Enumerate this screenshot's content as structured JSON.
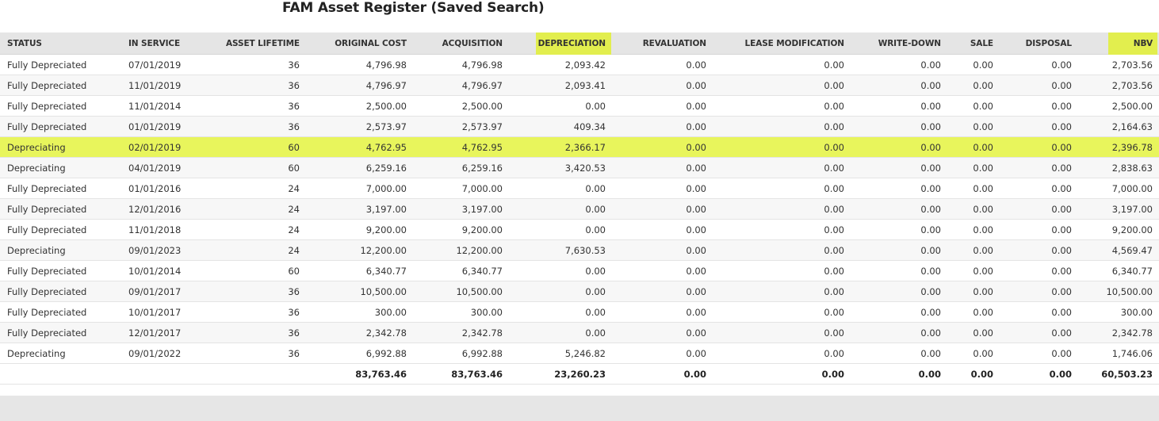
{
  "page": {
    "title": "FAM Asset Register (Saved Search)"
  },
  "colors": {
    "header_bg": "#e5e5e5",
    "highlight": "#e8f55c",
    "header_highlight": "#e2ee4e"
  },
  "table": {
    "columns": [
      "STATUS",
      "IN SERVICE",
      "ASSET LIFETIME",
      "ORIGINAL COST",
      "ACQUISITION",
      "DEPRECIATION",
      "REVALUATION",
      "LEASE MODIFICATION",
      "WRITE-DOWN",
      "SALE",
      "DISPOSAL",
      "NBV"
    ],
    "highlighted_columns": [
      "DEPRECIATION",
      "NBV"
    ],
    "rows": [
      [
        "Fully Depreciated",
        "07/01/2019",
        "36",
        "4,796.98",
        "4,796.98",
        "2,093.42",
        "0.00",
        "0.00",
        "0.00",
        "0.00",
        "0.00",
        "2,703.56"
      ],
      [
        "Fully Depreciated",
        "11/01/2019",
        "36",
        "4,796.97",
        "4,796.97",
        "2,093.41",
        "0.00",
        "0.00",
        "0.00",
        "0.00",
        "0.00",
        "2,703.56"
      ],
      [
        "Fully Depreciated",
        "11/01/2014",
        "36",
        "2,500.00",
        "2,500.00",
        "0.00",
        "0.00",
        "0.00",
        "0.00",
        "0.00",
        "0.00",
        "2,500.00"
      ],
      [
        "Fully Depreciated",
        "01/01/2019",
        "36",
        "2,573.97",
        "2,573.97",
        "409.34",
        "0.00",
        "0.00",
        "0.00",
        "0.00",
        "0.00",
        "2,164.63"
      ],
      [
        "Depreciating",
        "02/01/2019",
        "60",
        "4,762.95",
        "4,762.95",
        "2,366.17",
        "0.00",
        "0.00",
        "0.00",
        "0.00",
        "0.00",
        "2,396.78"
      ],
      [
        "Depreciating",
        "04/01/2019",
        "60",
        "6,259.16",
        "6,259.16",
        "3,420.53",
        "0.00",
        "0.00",
        "0.00",
        "0.00",
        "0.00",
        "2,838.63"
      ],
      [
        "Fully Depreciated",
        "01/01/2016",
        "24",
        "7,000.00",
        "7,000.00",
        "0.00",
        "0.00",
        "0.00",
        "0.00",
        "0.00",
        "0.00",
        "7,000.00"
      ],
      [
        "Fully Depreciated",
        "12/01/2016",
        "24",
        "3,197.00",
        "3,197.00",
        "0.00",
        "0.00",
        "0.00",
        "0.00",
        "0.00",
        "0.00",
        "3,197.00"
      ],
      [
        "Fully Depreciated",
        "11/01/2018",
        "24",
        "9,200.00",
        "9,200.00",
        "0.00",
        "0.00",
        "0.00",
        "0.00",
        "0.00",
        "0.00",
        "9,200.00"
      ],
      [
        "Depreciating",
        "09/01/2023",
        "24",
        "12,200.00",
        "12,200.00",
        "7,630.53",
        "0.00",
        "0.00",
        "0.00",
        "0.00",
        "0.00",
        "4,569.47"
      ],
      [
        "Fully Depreciated",
        "10/01/2014",
        "60",
        "6,340.77",
        "6,340.77",
        "0.00",
        "0.00",
        "0.00",
        "0.00",
        "0.00",
        "0.00",
        "6,340.77"
      ],
      [
        "Fully Depreciated",
        "09/01/2017",
        "36",
        "10,500.00",
        "10,500.00",
        "0.00",
        "0.00",
        "0.00",
        "0.00",
        "0.00",
        "0.00",
        "10,500.00"
      ],
      [
        "Fully Depreciated",
        "10/01/2017",
        "36",
        "300.00",
        "300.00",
        "0.00",
        "0.00",
        "0.00",
        "0.00",
        "0.00",
        "0.00",
        "300.00"
      ],
      [
        "Fully Depreciated",
        "12/01/2017",
        "36",
        "2,342.78",
        "2,342.78",
        "0.00",
        "0.00",
        "0.00",
        "0.00",
        "0.00",
        "0.00",
        "2,342.78"
      ],
      [
        "Depreciating",
        "09/01/2022",
        "36",
        "6,992.88",
        "6,992.88",
        "5,246.82",
        "0.00",
        "0.00",
        "0.00",
        "0.00",
        "0.00",
        "1,746.06"
      ]
    ],
    "highlighted_row_index": 4,
    "totals": [
      "",
      "",
      "",
      "83,763.46",
      "83,763.46",
      "23,260.23",
      "0.00",
      "0.00",
      "0.00",
      "0.00",
      "0.00",
      "60,503.23"
    ]
  }
}
